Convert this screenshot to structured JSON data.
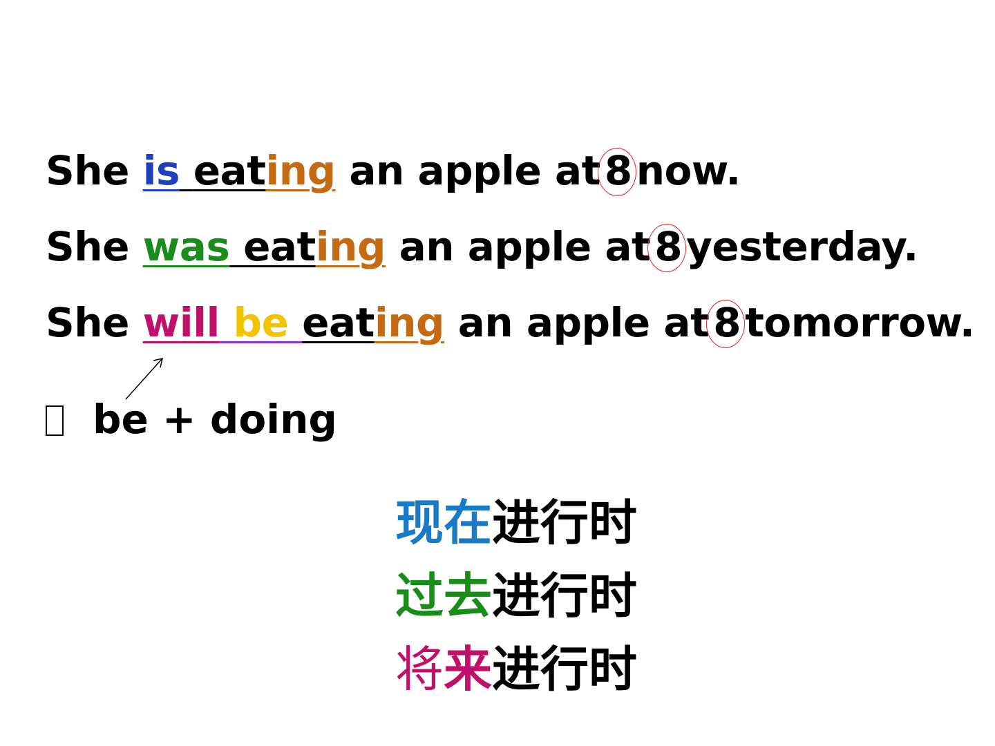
{
  "sentences": [
    {
      "subject": "She",
      "aux1": "is",
      "aux2": "",
      "verb_stem": "eat",
      "verb_suffix": "ing",
      "middle": "an apple at",
      "number": "8",
      "tail": "now."
    },
    {
      "subject": "She",
      "aux1": "was",
      "aux2": "",
      "verb_stem": "eat",
      "verb_suffix": "ing",
      "middle": "an apple at",
      "number": "8",
      "tail": "yesterday."
    },
    {
      "subject": "She",
      "aux1": "will",
      "aux2": "be",
      "verb_stem": "eat",
      "verb_suffix": "ing",
      "middle": "an apple at",
      "number": "8",
      "tail": "tomorrow."
    }
  ],
  "formula": {
    "text": "be + doing"
  },
  "tenses": [
    {
      "colored": "现在",
      "rest": "进行时"
    },
    {
      "colored": "过去",
      "rest": "进行时"
    },
    {
      "colored_a": "将",
      "colored_b": "来",
      "rest": "进行时"
    }
  ],
  "colors": {
    "is": "#1f3fbf",
    "was": "#1a8c1a",
    "will": "#c0106a",
    "be": "#f2c400",
    "ing": "#c46a12",
    "circle": "#e02020",
    "present": "#1a7ac8",
    "past": "#1a8c1a",
    "future": "#c0106a"
  }
}
